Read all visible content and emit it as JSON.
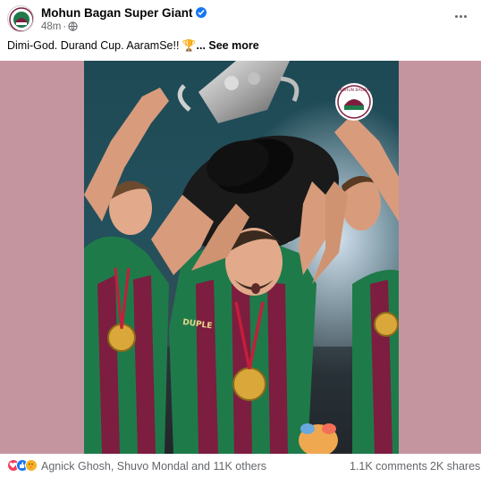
{
  "post": {
    "page_name": "Mohun Bagan Super Giant",
    "timestamp": "48m",
    "privacy_icon": "globe-icon",
    "caption_text": "Dimi-God. Durand Cup. AaramSe!! ",
    "caption_emoji": "🏆",
    "see_more_label": "... See more"
  },
  "photo": {
    "badge_text": "MOHUN BAGAN",
    "jersey_text": "DUPLE"
  },
  "footer": {
    "reaction_icons": [
      "love-icon",
      "like-icon",
      "care-icon"
    ],
    "reaction_names": "Agnick Ghosh, Shuvo Mondal and 11K others",
    "comments": "1.1K comments",
    "shares": "2K shares"
  },
  "colors": {
    "accent": "#1877f2",
    "secondary_text": "#65676b",
    "media_background": "#c5959f",
    "jersey_maroon": "#7d1d3f",
    "jersey_green": "#1f7a4a"
  }
}
